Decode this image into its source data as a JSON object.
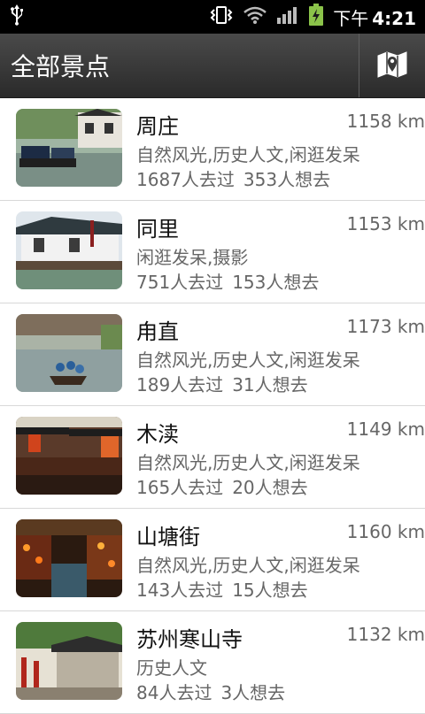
{
  "status_bar": {
    "ampm": "下午",
    "time": "4:21",
    "icons": [
      "usb-icon",
      "vibrate-icon",
      "wifi-icon",
      "signal-icon",
      "battery-charging-icon"
    ]
  },
  "header": {
    "title": "全部景点",
    "map_icon": "map-marker-icon"
  },
  "spots": [
    {
      "name": "周庄",
      "distance": "1158 km",
      "tags": "自然风光,历史人文,闲逛发呆",
      "visited": "1687人去过",
      "want": "353人想去"
    },
    {
      "name": "同里",
      "distance": "1153 km",
      "tags": "闲逛发呆,摄影",
      "visited": "751人去过",
      "want": "153人想去"
    },
    {
      "name": "甪直",
      "distance": "1173 km",
      "tags": "自然风光,历史人文,闲逛发呆",
      "visited": "189人去过",
      "want": "31人想去"
    },
    {
      "name": "木渎",
      "distance": "1149 km",
      "tags": "自然风光,历史人文,闲逛发呆",
      "visited": "165人去过",
      "want": "20人想去"
    },
    {
      "name": "山塘街",
      "distance": "1160 km",
      "tags": "自然风光,历史人文,闲逛发呆",
      "visited": "143人去过",
      "want": "15人想去"
    },
    {
      "name": "苏州寒山寺",
      "distance": "1132 km",
      "tags": "历史人文",
      "visited": "84人去过",
      "want": "3人想去"
    }
  ]
}
